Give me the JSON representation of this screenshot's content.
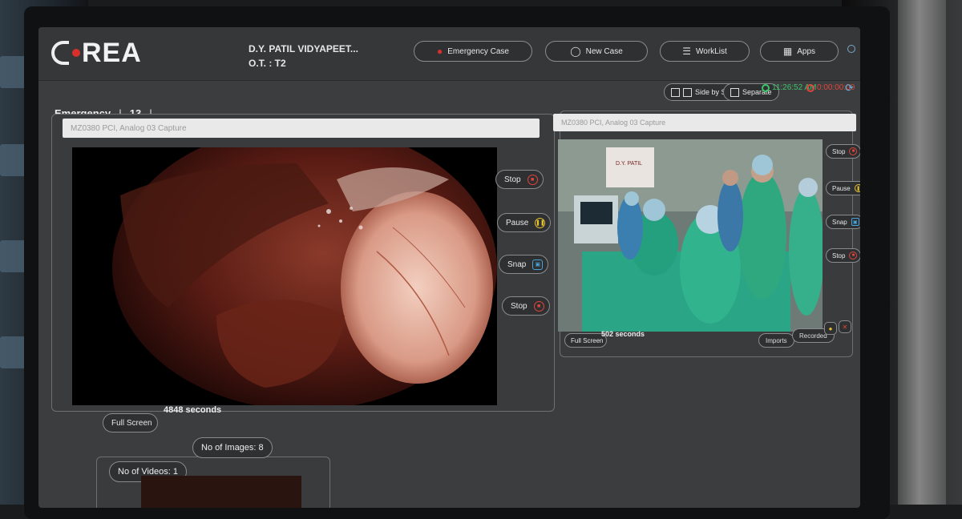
{
  "header": {
    "logo_text": "REA",
    "hospital_name": "D.Y. PATIL VIDYAPEET...",
    "ot_label": "O.T. : T2",
    "buttons": {
      "emergency_case": "Emergency Case",
      "new_case": "New Case",
      "worklist": "WorkList",
      "apps": "Apps"
    }
  },
  "status": {
    "side_by_side": "Side by Side",
    "separate": "Separate",
    "clock_time": "11:26:52 AM",
    "record_timer": "0:00:00:00"
  },
  "case": {
    "label": "Emergency",
    "number": "13",
    "more": "..."
  },
  "left_feed": {
    "caption": "MZ0380 PCI, Analog 03 Capture",
    "controls": {
      "stop": "Stop",
      "pause": "Pause",
      "snap": "Snap",
      "stop2": "Stop"
    },
    "fullscreen": "Full Screen",
    "seconds": "4848 seconds"
  },
  "right_feed": {
    "caption": "MZ0380 PCI, Analog 03 Capture",
    "controls": {
      "stop": "Stop",
      "pause": "Pause",
      "snap": "Snap",
      "stop2": "Stop"
    },
    "fullscreen": "Full Screen",
    "seconds": "502 seconds",
    "imports": "Imports",
    "recorded": "Recorded",
    "banner_text": "D.Y. PATIL"
  },
  "media_counts": {
    "videos": "No of Videos: 1",
    "images": "No of Images: 8"
  },
  "colors": {
    "accent_red": "#d9302b",
    "clock_green": "#3cc46a",
    "timer_red": "#e0453d",
    "pause_yellow": "#e5c22e",
    "snap_blue": "#4aa3d8",
    "refresh_blue": "#6bb0d6"
  },
  "icons": {
    "emergency": "ambulance-icon",
    "new_case": "user-icon",
    "worklist": "list-icon",
    "apps": "apps-grid-icon",
    "stop": "stop-icon",
    "pause": "pause-icon",
    "snap": "camera-icon",
    "clock": "clock-icon",
    "timer": "stopwatch-icon",
    "refresh": "refresh-icon"
  }
}
